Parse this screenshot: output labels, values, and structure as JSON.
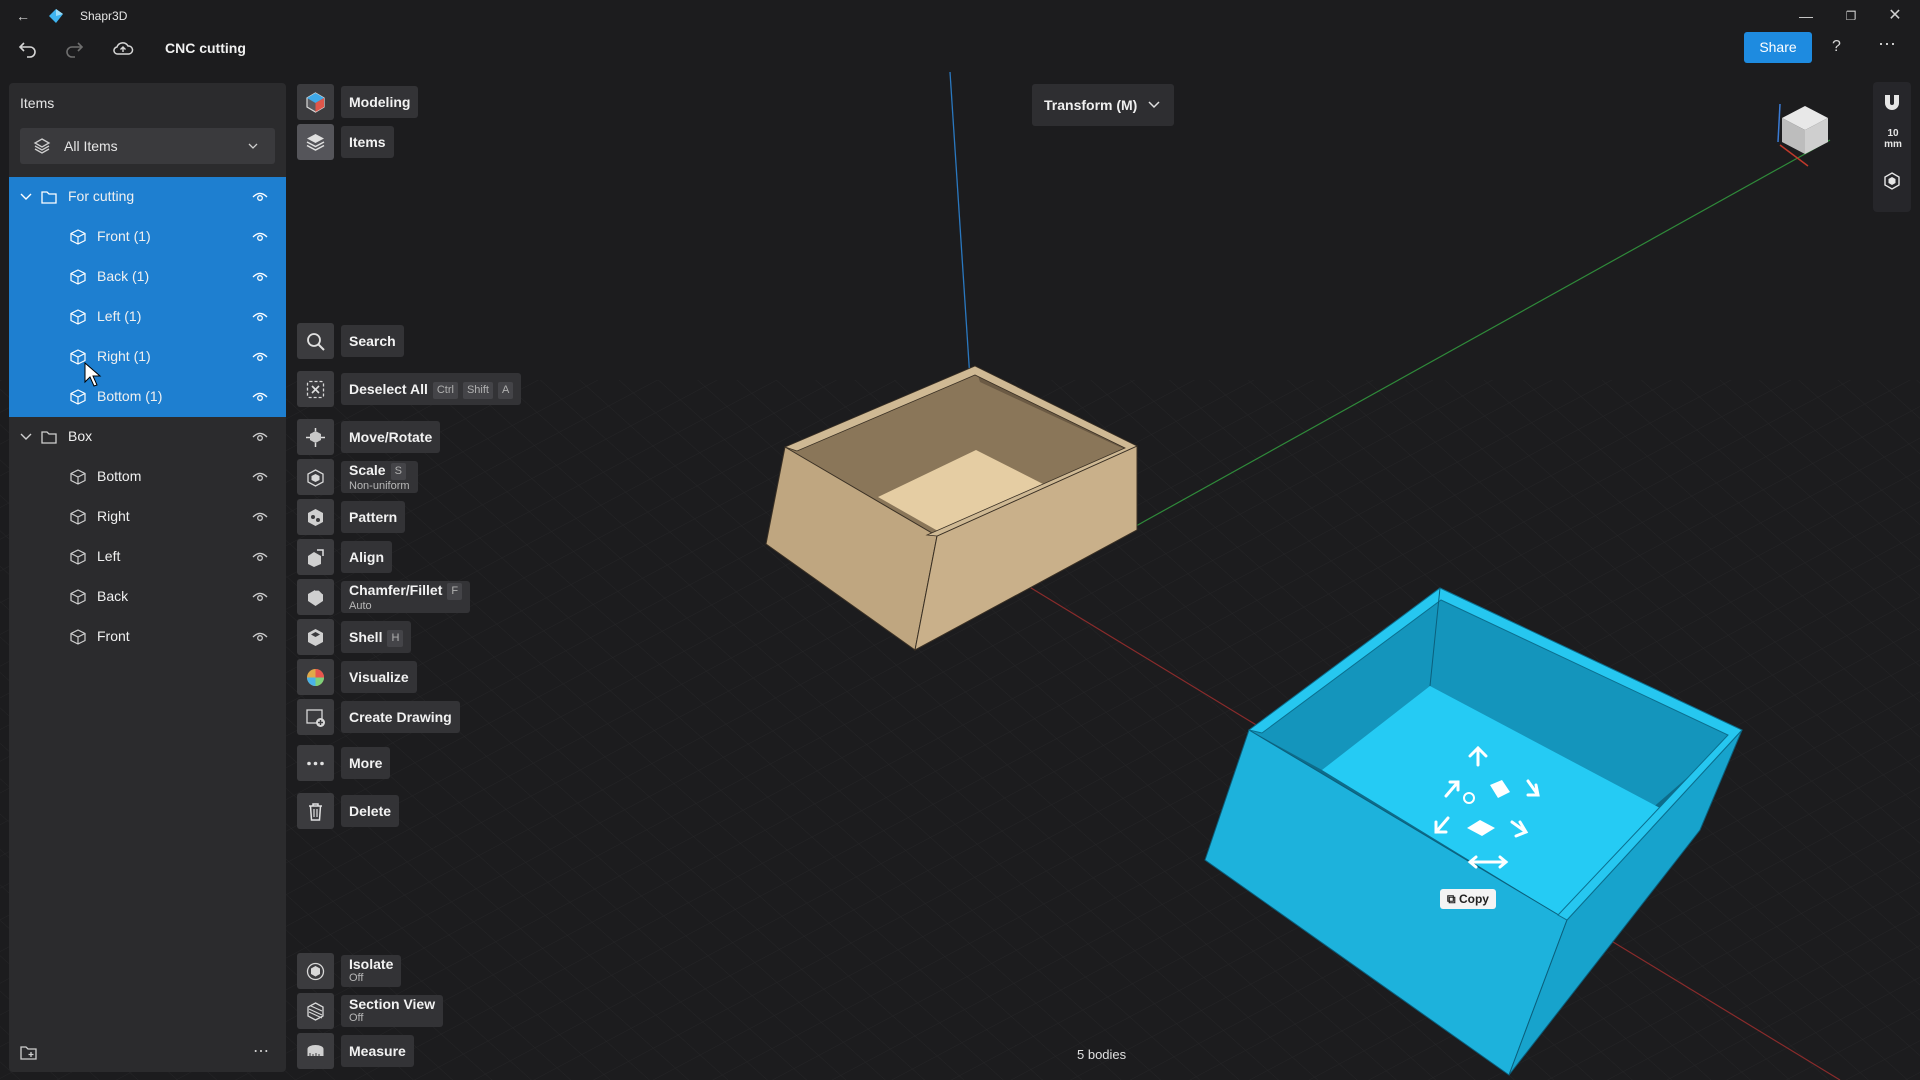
{
  "app": {
    "name": "Shapr3D",
    "document_title": "CNC cutting",
    "share_label": "Share"
  },
  "panel": {
    "title": "Items",
    "filter": "All Items",
    "groups": [
      {
        "name": "For cutting",
        "items": [
          "Front (1)",
          "Back (1)",
          "Left (1)",
          "Right (1)",
          "Bottom (1)"
        ]
      },
      {
        "name": "Box",
        "items": [
          "Bottom",
          "Right",
          "Left",
          "Back",
          "Front"
        ]
      }
    ]
  },
  "modes": {
    "modeling": "Modeling",
    "items": "Items"
  },
  "tools": {
    "search": "Search",
    "deselect_all": "Deselect All",
    "deselect_keys": [
      "Ctrl",
      "Shift",
      "A"
    ],
    "move_rotate": "Move/Rotate",
    "scale": "Scale",
    "scale_key": "S",
    "scale_sub": "Non-uniform",
    "pattern": "Pattern",
    "align": "Align",
    "chamfer": "Chamfer/Fillet",
    "chamfer_key": "F",
    "chamfer_sub": "Auto",
    "shell": "Shell",
    "shell_key": "H",
    "visualize": "Visualize",
    "create_drawing": "Create Drawing",
    "more": "More",
    "delete": "Delete",
    "isolate": "Isolate",
    "isolate_sub": "Off",
    "section_view": "Section View",
    "section_sub": "Off",
    "measure": "Measure"
  },
  "viewport": {
    "transform_mode": "Transform (M)",
    "status": "5 bodies",
    "copy_label": "Copy",
    "units": "10\nmm"
  },
  "colors": {
    "accent": "#1e8be0",
    "selection": "#1e7fd0",
    "selected_body": "#20c4f0",
    "wood": "#c9b08a"
  }
}
